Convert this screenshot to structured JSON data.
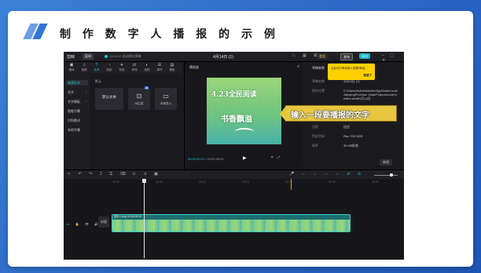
{
  "slide": {
    "heading": "制 作 数 字 人 播 报 的 示 例",
    "accent_color": "#2f74d6"
  },
  "app": {
    "logo": "剪映",
    "menu_label": "菜单",
    "autosave": "13:24:12 自动保存草稿",
    "title": "4月14日 (1)",
    "pro_label": "会员",
    "share_label": "发布",
    "export_label": "导出",
    "toolbar": [
      {
        "icon": "media-icon",
        "label": "媒体"
      },
      {
        "icon": "audio-icon",
        "label": "音频"
      },
      {
        "icon": "text-icon",
        "label": "文本"
      },
      {
        "icon": "sticker-icon",
        "label": "贴纸"
      },
      {
        "icon": "effects-icon",
        "label": "特效"
      },
      {
        "icon": "transition-icon",
        "label": "转场"
      },
      {
        "icon": "filter-icon",
        "label": "滤镜"
      },
      {
        "icon": "adjust-icon",
        "label": "调节"
      },
      {
        "icon": "template-icon",
        "label": "模板"
      }
    ],
    "text_categories": [
      "新建文本",
      "花字",
      "文字模板",
      "智能字幕",
      "识别歌词",
      "本地字幕"
    ],
    "assets_section": "默认",
    "asset_cards": [
      {
        "title": "默认文本",
        "label": ""
      },
      {
        "title": "",
        "label": "AI生成",
        "tag": "AI"
      },
      {
        "title": "",
        "label": "本地导入"
      }
    ],
    "player": {
      "header": "播放器",
      "video_line1": "4.23全民阅读",
      "video_line2": "书香飘溢",
      "timecode_current": "00:00:00:21",
      "timecode_total": "00:00:05:00"
    },
    "callout_text": "输入一段要播报的文字",
    "properties": {
      "header": "草稿参数",
      "rows": [
        {
          "label": "草稿名称",
          "value": "4月14日 (1)"
        },
        {
          "label": "保存位置",
          "value": "C:/Users/Administrator/AppData/Local/JianyingPro/User Data/Projects/com.lveditor.draft/4月14日"
        },
        {
          "label": "比例",
          "value": "适应"
        },
        {
          "label": "色彩空间",
          "value": "Rec.709 SDR"
        },
        {
          "label": "帧率",
          "value": "30.00帧/秒"
        }
      ],
      "edit_button": "修改"
    },
    "tooltip": {
      "text": "点此可分享给他人查看/审阅。",
      "confirm": "知道了"
    },
    "timeline": {
      "ruler_ticks": [
        "00:00",
        "00:05",
        "00:10",
        "00:15",
        "00:20",
        "00:25",
        "00:30"
      ],
      "cover_label": "封面",
      "clip_label": "图片1.png 00:00:05:00"
    }
  }
}
